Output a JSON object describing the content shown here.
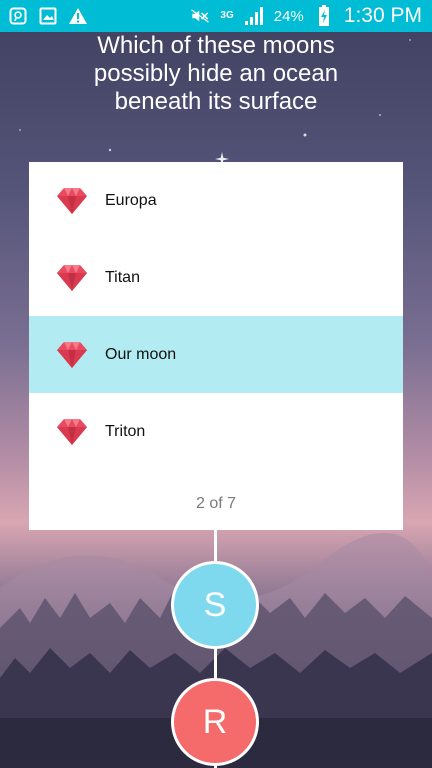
{
  "status_bar": {
    "network": "3G",
    "battery": "24%",
    "time": "1:30 PM",
    "color": "#00bcd4",
    "left_icons": [
      "chat-icon",
      "image-icon",
      "warning-icon"
    ],
    "right_icons": [
      "mute-icon",
      "signal-icon",
      "battery-charging-icon"
    ]
  },
  "question": {
    "line1": "Which of these moons",
    "line2": "possibly hide an ocean",
    "line3": "beneath its surface"
  },
  "options": [
    {
      "label": "Europa",
      "icon": "gem-icon",
      "selected": false
    },
    {
      "label": "Titan",
      "icon": "gem-icon",
      "selected": false
    },
    {
      "label": "Our moon",
      "icon": "gem-icon",
      "selected": true
    },
    {
      "label": "Triton",
      "icon": "gem-icon",
      "selected": false
    }
  ],
  "progress": "2 of 7",
  "players": [
    {
      "initial": "S",
      "color": "#7fd9ee"
    },
    {
      "initial": "R",
      "color": "#f56a6a"
    }
  ],
  "colors": {
    "selected_option": "#b3ebf2",
    "gem": "#e84a5f"
  }
}
